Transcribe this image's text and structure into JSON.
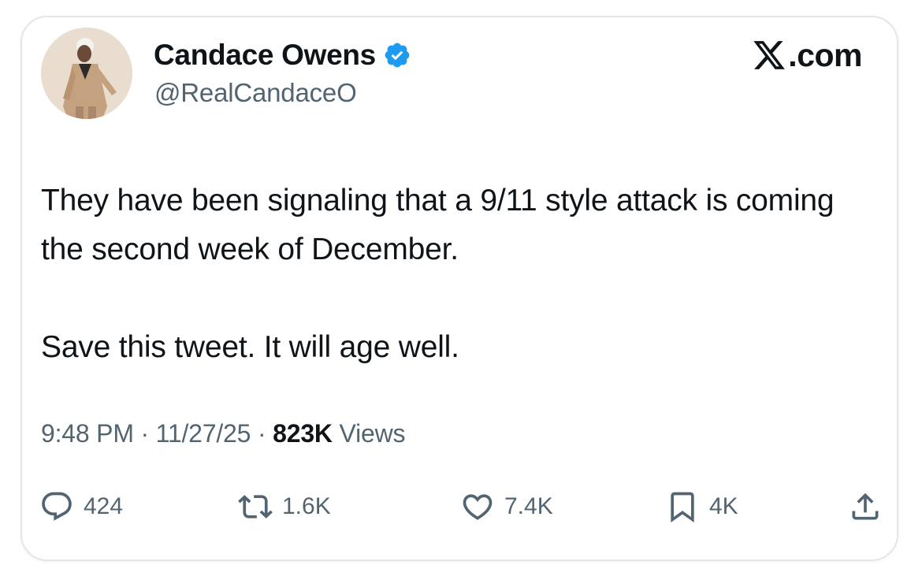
{
  "tweet": {
    "author": {
      "name": "Candace Owens",
      "handle": "@RealCandaceO",
      "verified": true,
      "avatar_icon": "profile-photo-avatar"
    },
    "brand": {
      "text": ".com",
      "logo_icon": "x-logo-icon"
    },
    "text": {
      "line1": "They have been signaling that a 9/11 style attack is coming the second week of December.",
      "line2": "Save this tweet. It will age well."
    },
    "meta": {
      "time": "9:48 PM",
      "separator": "·",
      "date": "11/27/25",
      "views_count": "823K",
      "views_label": "Views"
    },
    "actions": {
      "replies": "424",
      "reposts": "1.6K",
      "likes": "7.4K",
      "bookmarks": "4K"
    }
  },
  "colors": {
    "text_primary": "#0f1419",
    "text_secondary": "#536471",
    "verified_badge": "#1d9bf0",
    "border": "#e3e6ea"
  }
}
